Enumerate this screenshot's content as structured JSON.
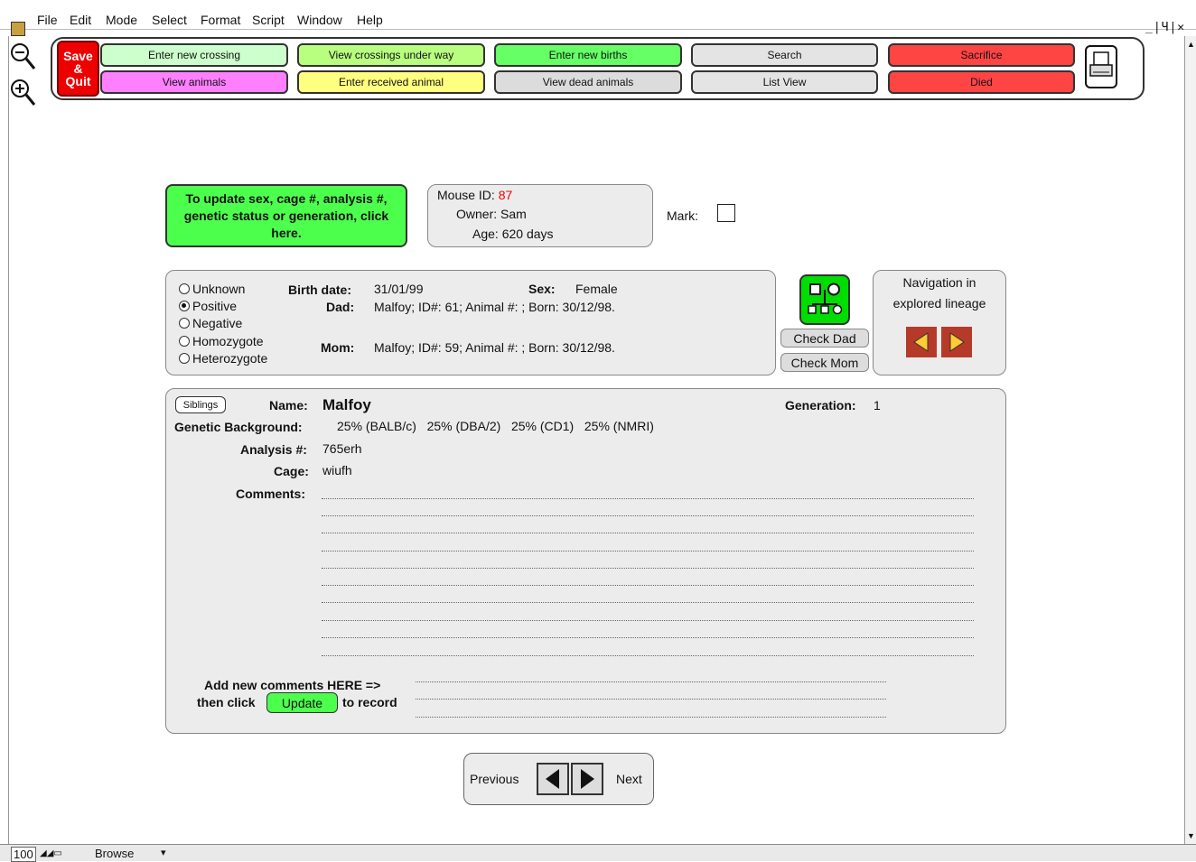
{
  "menu": {
    "items": [
      "File",
      "Edit",
      "Mode",
      "Select",
      "Format",
      "Script",
      "Window",
      "Help"
    ],
    "window_controls": "_|Ч|✕"
  },
  "toolbar": {
    "save_quit": [
      "Save",
      "&",
      "Quit"
    ],
    "buttons": [
      {
        "label": "Enter new crossing",
        "color": "#ccffcc"
      },
      {
        "label": "View animals",
        "color": "#ff80ff"
      },
      {
        "label": "View crossings under way",
        "color": "#b8ff80"
      },
      {
        "label": "Enter received animal",
        "color": "#ffff80"
      },
      {
        "label": "Enter new births",
        "color": "#66ff66"
      },
      {
        "label": "View dead animals",
        "color": "#dcdcdc"
      },
      {
        "label": "Search",
        "color": "#e4e4e4"
      },
      {
        "label": "List View",
        "color": "#e4e4e4"
      },
      {
        "label": "Sacrifice",
        "color": "#ff4444"
      },
      {
        "label": "Died",
        "color": "#ff4444"
      }
    ],
    "print_icon": "printer-icon"
  },
  "note": {
    "text": "To update sex, cage #, analysis #, genetic status or generation, click here."
  },
  "mouse_info": {
    "id_label": "Mouse ID:",
    "id_value": "87",
    "owner": "Owner: Sam",
    "age": "Age: 620 days",
    "mark_label": "Mark:"
  },
  "genetic_status": {
    "options": [
      "Unknown",
      "Positive",
      "Negative",
      "Homozygote",
      "Heterozygote"
    ],
    "selected": "Positive"
  },
  "birth": {
    "birth_label": "Birth date:",
    "birth_value": "31/01/99",
    "sex_label": "Sex:",
    "sex_value": "Female",
    "dad_label": "Dad:",
    "dad_value": "Malfoy; ID#: 61; Animal #: ; Born: 30/12/98.",
    "mom_label": "Mom:",
    "mom_value": "Malfoy; ID#: 59; Animal #: ; Born: 30/12/98."
  },
  "lineage": {
    "check_dad": "Check Dad",
    "check_mom": "Check Mom",
    "nav_title": "Navigation in explored lineage"
  },
  "details": {
    "siblings": "Siblings",
    "name_label": "Name:",
    "name_value": "Malfoy",
    "generation_label": "Generation:",
    "generation_value": "1",
    "background_label": "Genetic Background:",
    "background_value": "25% (BALB/c)   25% (DBA/2)   25% (CD1)   25% (NMRI)",
    "analysis_label": "Analysis #:",
    "analysis_value": "765erh",
    "cage_label": "Cage:",
    "cage_value": "wiufh",
    "comments_label": "Comments:",
    "add_comments_1": "Add new comments HERE =>",
    "add_comments_2": "then click",
    "update_btn": "Update",
    "add_comments_3": "to record"
  },
  "pager": {
    "previous": "Previous",
    "next": "Next"
  },
  "status": {
    "zoom": "100",
    "mode": "Browse"
  }
}
